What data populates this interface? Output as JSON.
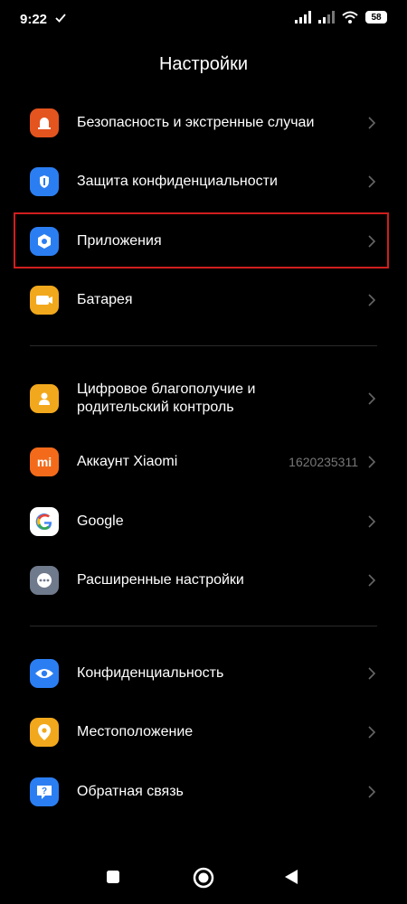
{
  "status_bar": {
    "time": "9:22",
    "battery": "58"
  },
  "header": {
    "title": "Настройки"
  },
  "settings": {
    "items": [
      {
        "label": "Безопасность и экстренные случаи",
        "icon": "emergency-bell-icon",
        "color": "#e4541f"
      },
      {
        "label": "Защита конфиденциальности",
        "icon": "privacy-protection-icon",
        "color": "#2b7ef2"
      },
      {
        "label": "Приложения",
        "icon": "apps-gear-icon",
        "color": "#2b7ef2"
      },
      {
        "label": "Батарея",
        "icon": "battery-icon",
        "color": "#f2a81c"
      },
      {
        "label_line1": "Цифровое благополучие и",
        "label_line2": "родительский контроль",
        "icon": "digital-wellbeing-icon",
        "color": "#f2a81c"
      },
      {
        "label": "Аккаунт Xiaomi",
        "value": "1620235311",
        "icon": "xiaomi-logo-icon",
        "icon_text": "mi",
        "color": "#f36b1a"
      },
      {
        "label": "Google",
        "icon": "google-icon",
        "color": "#ffffff"
      },
      {
        "label": "Расширенные настройки",
        "icon": "more-options-icon",
        "color": "#6f7a8c"
      },
      {
        "label": "Конфиденциальность",
        "icon": "eye-icon",
        "color": "#2b7ef2"
      },
      {
        "label": "Местоположение",
        "icon": "location-pin-icon",
        "color": "#f2a81c"
      },
      {
        "label": "Обратная связь",
        "icon": "feedback-icon",
        "color": "#2b7ef2"
      }
    ]
  },
  "colors": {
    "background": "#000000",
    "highlight": "#d01e1e",
    "divider": "#2a2a2a"
  }
}
